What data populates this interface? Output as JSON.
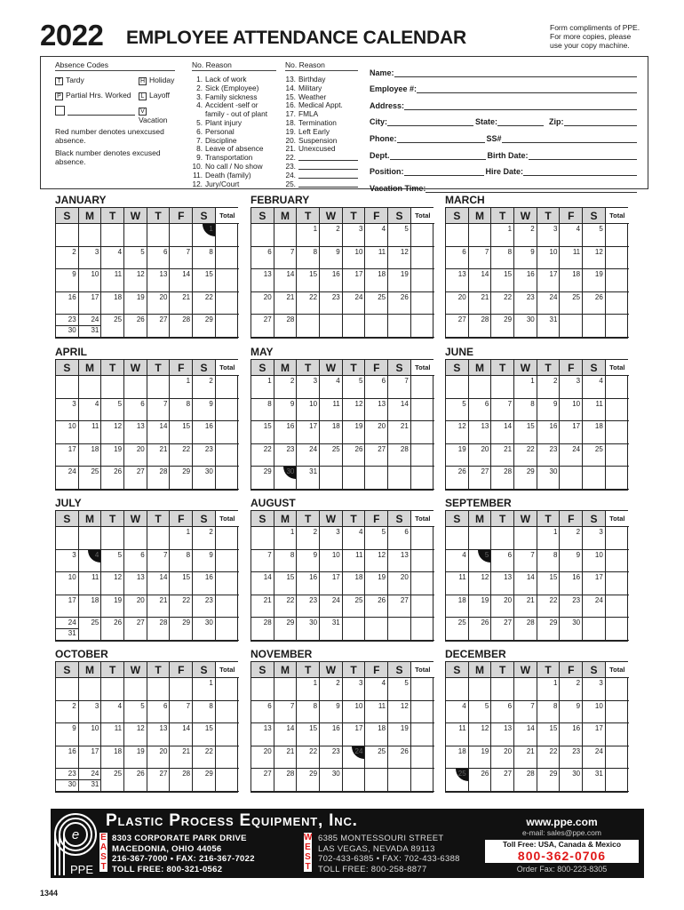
{
  "header": {
    "year": "2022",
    "title": "EMPLOYEE ATTENDANCE CALENDAR",
    "compliments": [
      "Form compliments of PPE.",
      "For more copies, please",
      "use your copy machine."
    ]
  },
  "absence_codes": {
    "heading": "Absence Codes",
    "codes": [
      {
        "code": "T",
        "label": "Tardy"
      },
      {
        "code": "H",
        "label": "Holiday"
      },
      {
        "code": "P",
        "label": "Partial Hrs. Worked"
      },
      {
        "code": "L",
        "label": "Layoff"
      },
      {
        "code": "",
        "label": ""
      },
      {
        "code": "V",
        "label": "Vacation"
      }
    ],
    "note_red": "Red number denotes unexcused absence.",
    "note_black": "Black number denotes excused absence."
  },
  "reasons": {
    "heading": "No. Reason",
    "col1": [
      {
        "n": "1.",
        "text": "Lack of work"
      },
      {
        "n": "2.",
        "text": "Sick (Employee)"
      },
      {
        "n": "3.",
        "text": "Family sickness"
      },
      {
        "n": "4.",
        "text": "Accident -self or"
      },
      {
        "n": "",
        "text": "family - out of plant"
      },
      {
        "n": "5.",
        "text": "Plant injury"
      },
      {
        "n": "6.",
        "text": "Personal"
      },
      {
        "n": "7.",
        "text": "Discipline"
      },
      {
        "n": "8.",
        "text": "Leave of absence"
      },
      {
        "n": "9.",
        "text": "Transportation"
      },
      {
        "n": "10.",
        "text": "No call / No show"
      },
      {
        "n": "11.",
        "text": "Death (family)"
      },
      {
        "n": "12.",
        "text": "Jury/Court"
      }
    ],
    "col2": [
      {
        "n": "13.",
        "text": "Birthday"
      },
      {
        "n": "14.",
        "text": "Military"
      },
      {
        "n": "15.",
        "text": "Weather"
      },
      {
        "n": "16.",
        "text": "Medical Appt."
      },
      {
        "n": "17.",
        "text": "FMLA"
      },
      {
        "n": "18.",
        "text": "Termination"
      },
      {
        "n": "19.",
        "text": "Left Early"
      },
      {
        "n": "20.",
        "text": "Suspension"
      },
      {
        "n": "21.",
        "text": "Unexcused"
      },
      {
        "n": "22.",
        "text": ""
      },
      {
        "n": "23.",
        "text": ""
      },
      {
        "n": "24.",
        "text": ""
      },
      {
        "n": "25.",
        "text": ""
      }
    ]
  },
  "fields": {
    "name": "Name:",
    "employee_no": "Employee #:",
    "address": "Address:",
    "city": "City:",
    "state": "State:",
    "zip": "Zip:",
    "phone": "Phone:",
    "ss": "SS#",
    "dept": "Dept.",
    "birth_date": "Birth Date:",
    "position": "Position:",
    "hire_date": "Hire Date:",
    "vacation_time": "Vacation Time:"
  },
  "weekdays": [
    "S",
    "M",
    "T",
    "W",
    "T",
    "F",
    "S"
  ],
  "total_label": "Total",
  "months": [
    {
      "name": "JANUARY",
      "start": 6,
      "days": 31,
      "holidays": [
        1
      ]
    },
    {
      "name": "FEBRUARY",
      "start": 2,
      "days": 28,
      "holidays": []
    },
    {
      "name": "MARCH",
      "start": 2,
      "days": 31,
      "holidays": []
    },
    {
      "name": "APRIL",
      "start": 5,
      "days": 30,
      "holidays": []
    },
    {
      "name": "MAY",
      "start": 0,
      "days": 31,
      "holidays": [
        30
      ]
    },
    {
      "name": "JUNE",
      "start": 3,
      "days": 30,
      "holidays": []
    },
    {
      "name": "JULY",
      "start": 5,
      "days": 31,
      "holidays": [
        4
      ]
    },
    {
      "name": "AUGUST",
      "start": 1,
      "days": 31,
      "holidays": []
    },
    {
      "name": "SEPTEMBER",
      "start": 4,
      "days": 30,
      "holidays": [
        5
      ]
    },
    {
      "name": "OCTOBER",
      "start": 6,
      "days": 31,
      "holidays": []
    },
    {
      "name": "NOVEMBER",
      "start": 2,
      "days": 30,
      "holidays": [
        24
      ]
    },
    {
      "name": "DECEMBER",
      "start": 4,
      "days": 31,
      "holidays": [
        25
      ]
    }
  ],
  "footer": {
    "company": "Plastic Process Equipment, Inc.",
    "logo_text": "PPE",
    "east_label": [
      "E",
      "A",
      "S",
      "T"
    ],
    "east": [
      "8303 CORPORATE PARK DRIVE",
      "MACEDONIA, OHIO 44056",
      "216-367-7000 • FAX: 216-367-7022",
      "TOLL FREE: 800-321-0562"
    ],
    "west_label": [
      "W",
      "E",
      "S",
      "T"
    ],
    "west": [
      "6385 MONTESSOURI STREET",
      "LAS VEGAS, NEVADA 89113",
      "702-433-6385 • FAX: 702-433-6388",
      "TOLL FREE: 800-258-8877"
    ],
    "website": "www.ppe.com",
    "email": "e-mail: sales@ppe.com",
    "toll_free_label": "Toll Free: USA, Canada & Mexico",
    "toll_free_number": "800-362-0706",
    "order_fax": "Order Fax: 800-223-8305",
    "accent_red": "#e01818"
  },
  "form_number": "1344"
}
